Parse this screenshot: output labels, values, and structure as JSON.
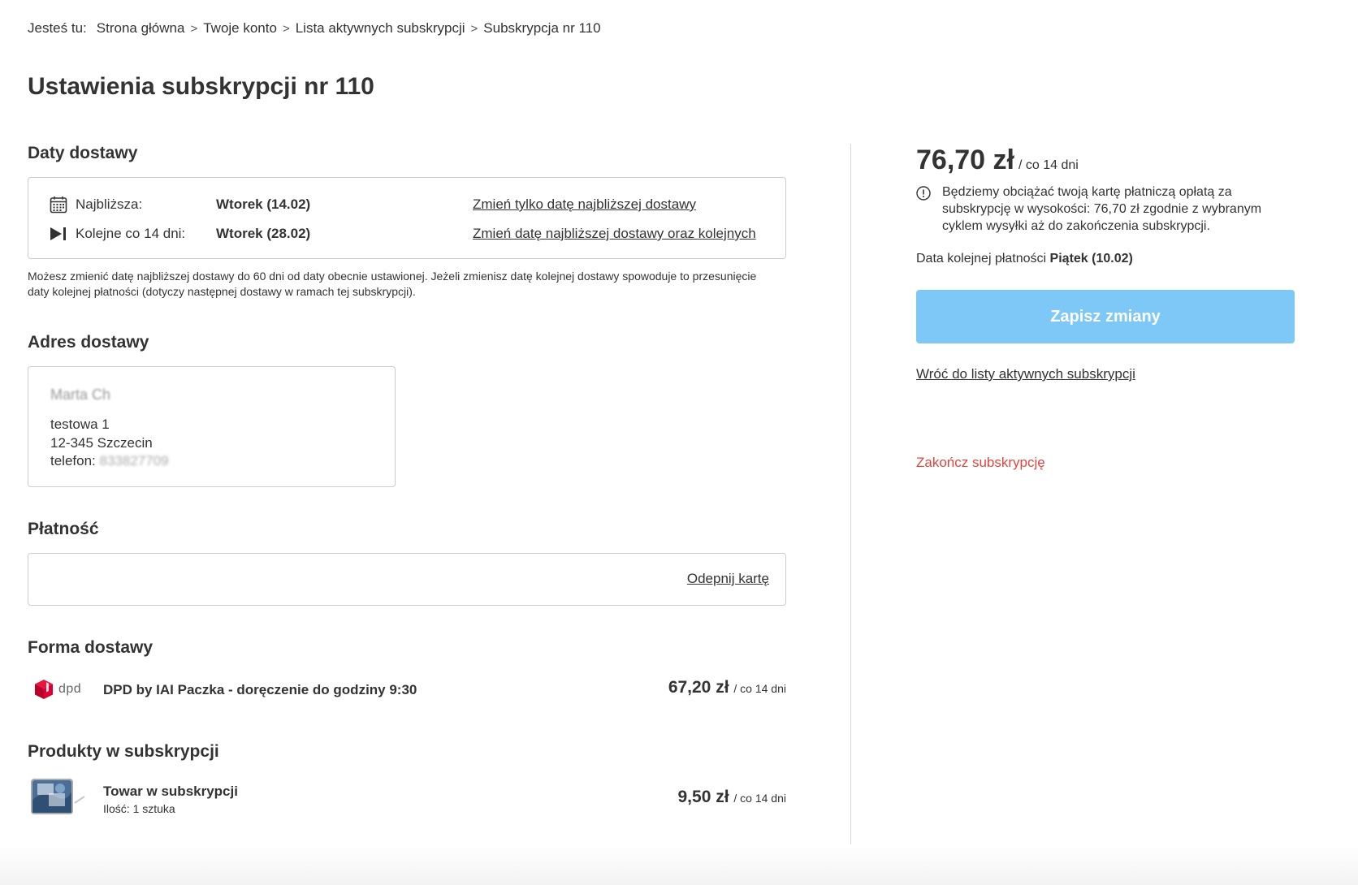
{
  "breadcrumb": {
    "prefix": "Jesteś tu:",
    "items": [
      "Strona główna",
      "Twoje konto",
      "Lista aktywnych subskrypcji",
      "Subskrypcja nr 110"
    ]
  },
  "page_title": "Ustawienia subskrypcji nr 110",
  "delivery_dates": {
    "title": "Daty dostawy",
    "nearest": {
      "label": "Najbliższa:",
      "value": "Wtorek (14.02)",
      "link": "Zmień tylko datę najbliższej dostawy",
      "icon": "calendar-icon"
    },
    "following": {
      "label": "Kolejne co 14 dni:",
      "value": "Wtorek (28.02)",
      "link": "Zmień datę najbliższej dostawy oraz kolejnych",
      "icon": "skip-next-icon"
    },
    "note": "Możesz zmienić datę najbliższej dostawy do 60 dni od daty obecnie ustawionej. Jeżeli zmienisz datę kolejnej dostawy spowoduje to przesunięcie daty kolejnej płatności (dotyczy następnej dostawy w ramach tej subskrypcji)."
  },
  "address": {
    "title": "Adres dostawy",
    "name": "Marta Ch",
    "street": "testowa 1",
    "city": "12-345 Szczecin",
    "phone_label": "telefon:",
    "phone_value": "833827709"
  },
  "payment": {
    "title": "Płatność",
    "unpin_link": "Odepnij kartę"
  },
  "shipping": {
    "title": "Forma dostawy",
    "logo_text": "dpd",
    "name": "DPD by IAI Paczka - doręczenie do godziny 9:30",
    "price": "67,20 zł",
    "period": "/ co 14 dni"
  },
  "products": {
    "title": "Produkty w subskrypcji",
    "items": [
      {
        "name": "Towar w subskrypcji",
        "qty": "Ilość: 1 sztuka",
        "price": "9,50 zł",
        "period": "/ co 14 dni"
      }
    ]
  },
  "summary": {
    "total": "76,70 zł",
    "period": "/ co 14 dni",
    "info": "Będziemy obciążać twoją kartę płatniczą opłatą za subskrypcję w wysokości: 76,70 zł zgodnie z wybranym cyklem wysyłki aż do zakończenia subskrypcji.",
    "next_payment_label": "Data kolejnej płatności",
    "next_payment_value": "Piątek (10.02)",
    "save_button": "Zapisz zmiany",
    "back_link": "Wróć do listy aktywnych subskrypcji",
    "end_link": "Zakończ subskrypcję"
  },
  "colors": {
    "primary_button": "#7ec8f8",
    "danger_link": "#e0453d",
    "text": "#333333",
    "border": "#cccccc",
    "dpd_red": "#dc0032"
  }
}
